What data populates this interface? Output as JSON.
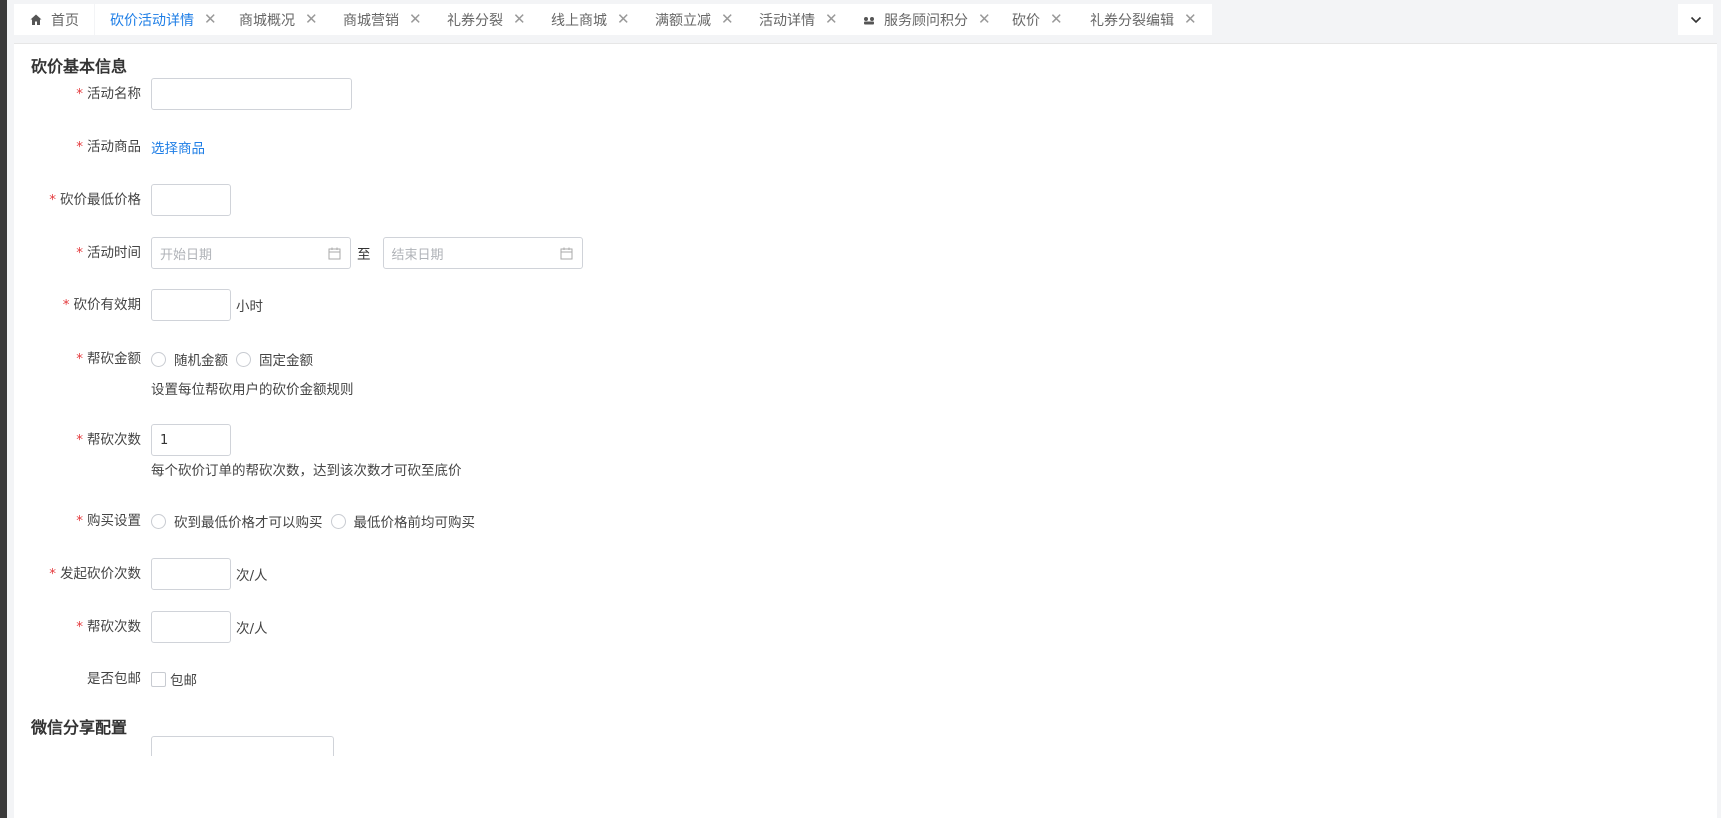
{
  "tabs": [
    {
      "label": "首页",
      "icon": "home-icon",
      "closable": false,
      "active": false
    },
    {
      "label": "砍价活动详情",
      "closable": true,
      "active": true
    },
    {
      "label": "商城概况",
      "closable": true,
      "active": false
    },
    {
      "label": "商城营销",
      "closable": true,
      "active": false
    },
    {
      "label": "礼券分裂",
      "closable": true,
      "active": false
    },
    {
      "label": "线上商城",
      "closable": true,
      "active": false
    },
    {
      "label": "满额立减",
      "closable": true,
      "active": false
    },
    {
      "label": "活动详情",
      "closable": true,
      "active": false
    },
    {
      "label": "服务顾问积分",
      "icon": "service-icon",
      "closable": true,
      "active": false
    },
    {
      "label": "砍价",
      "closable": true,
      "active": false
    },
    {
      "label": "礼券分裂编辑",
      "closable": true,
      "active": false
    }
  ],
  "close_glyph": "✕",
  "colors": {
    "accent": "#1e7ee6",
    "required": "#e4393c"
  },
  "section1_title": "砍价基本信息",
  "section2_title": "微信分享配置",
  "form": {
    "activity_name": {
      "label": "活动名称",
      "value": ""
    },
    "activity_goods": {
      "label": "活动商品",
      "link": "选择商品"
    },
    "min_price": {
      "label": "砍价最低价格",
      "value": ""
    },
    "activity_time": {
      "label": "活动时间",
      "start_placeholder": "开始日期",
      "end_placeholder": "结束日期",
      "separator": "至"
    },
    "validity": {
      "label": "砍价有效期",
      "value": "",
      "unit": "小时"
    },
    "help_amount": {
      "label": "帮砍金额",
      "options": [
        "随机金额",
        "固定金额"
      ],
      "hint": "设置每位帮砍用户的砍价金额规则"
    },
    "help_times": {
      "label": "帮砍次数",
      "value": "1",
      "hint": "每个砍价订单的帮砍次数，达到该次数才可砍至底价"
    },
    "purchase": {
      "label": "购买设置",
      "options": [
        "砍到最低价格才可以购买",
        "最低价格前均可购买"
      ]
    },
    "initiate_times": {
      "label": "发起砍价次数",
      "value": "",
      "unit": "次/人"
    },
    "help_times2": {
      "label": "帮砍次数",
      "value": "",
      "unit": "次/人"
    },
    "free_shipping": {
      "label": "是否包邮",
      "option": "包邮",
      "checked": false
    }
  }
}
